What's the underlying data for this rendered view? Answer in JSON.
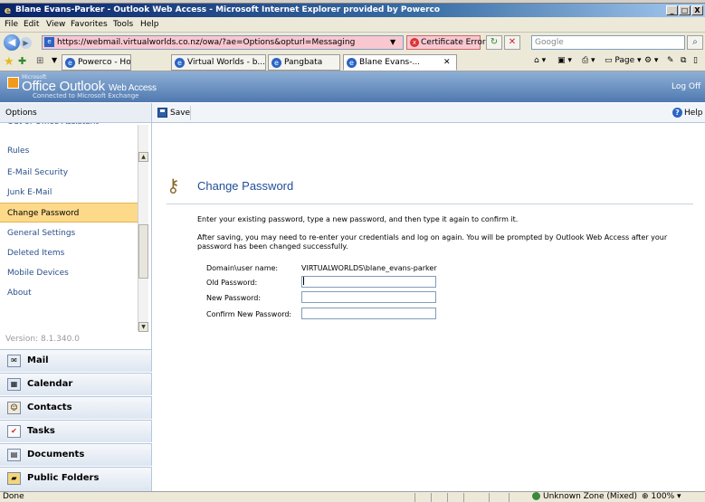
{
  "top_strip": "",
  "window": {
    "title": "Blane Evans-Parker - Outlook Web Access - Microsoft Internet Explorer provided by Powerco",
    "min_label": "_",
    "max_label": "□",
    "close_label": "X"
  },
  "menu": {
    "items": [
      "File",
      "Edit",
      "View",
      "Favorites",
      "Tools",
      "Help"
    ]
  },
  "address": {
    "url": "https://webmail.virtualworlds.co.nz/owa/?ae=Options&opturl=Messaging",
    "cert_error": "Certificate Error",
    "search_placeholder": "Google"
  },
  "tabs": [
    {
      "label": "Powerco - Home"
    },
    {
      "label": "Virtual Worlds - b..."
    },
    {
      "label": "Pangbata"
    },
    {
      "label": "Blane Evans-..."
    }
  ],
  "command_bar": {
    "page_label": "Page"
  },
  "owa": {
    "brand_small": "Microsoft",
    "brand": "Office Outlook",
    "brand_suffix": "Web Access",
    "subtitle": "Connected to Microsoft Exchange",
    "logoff": "Log Off"
  },
  "sidebar": {
    "header": "Options",
    "items": [
      {
        "label": "Out of Office Assistant"
      },
      {
        "label": "Rules"
      },
      {
        "label": "E-Mail Security"
      },
      {
        "label": "Junk E-Mail"
      },
      {
        "label": "Change Password"
      },
      {
        "label": "General Settings"
      },
      {
        "label": "Deleted Items"
      },
      {
        "label": "Mobile Devices"
      },
      {
        "label": "About"
      }
    ],
    "selected_index": 4,
    "version": "Version: 8.1.340.0"
  },
  "nav": [
    {
      "label": "Mail",
      "icon": "mail-icon"
    },
    {
      "label": "Calendar",
      "icon": "calendar-icon"
    },
    {
      "label": "Contacts",
      "icon": "contacts-icon"
    },
    {
      "label": "Tasks",
      "icon": "tasks-icon"
    },
    {
      "label": "Documents",
      "icon": "documents-icon"
    },
    {
      "label": "Public Folders",
      "icon": "public-folders-icon"
    }
  ],
  "toolbar": {
    "save_label": "Save",
    "help_label": "Help"
  },
  "main": {
    "title": "Change Password",
    "instruction": "Enter your existing password, type a new password, and then type it again to confirm it.",
    "note": "After saving, you may need to re-enter your credentials and log on again. You will be prompted by Outlook Web Access after your password has been changed successfully.",
    "domain_label": "Domain\\user name:",
    "domain_value": "VIRTUALWORLDS\\blane_evans-parker",
    "old_password_label": "Old Password:",
    "new_password_label": "New Password:",
    "confirm_password_label": "Confirm New Password:",
    "old_password_value": "",
    "new_password_value": "",
    "confirm_password_value": ""
  },
  "status": {
    "text": "Done",
    "zone": "Unknown Zone (Mixed)",
    "zoom": "100%"
  },
  "colors": {
    "owa_header": "#4f79b0",
    "selected_item": "#fdd98a",
    "title_blue": "#1f4e96",
    "link_blue": "#2a4f8a"
  }
}
